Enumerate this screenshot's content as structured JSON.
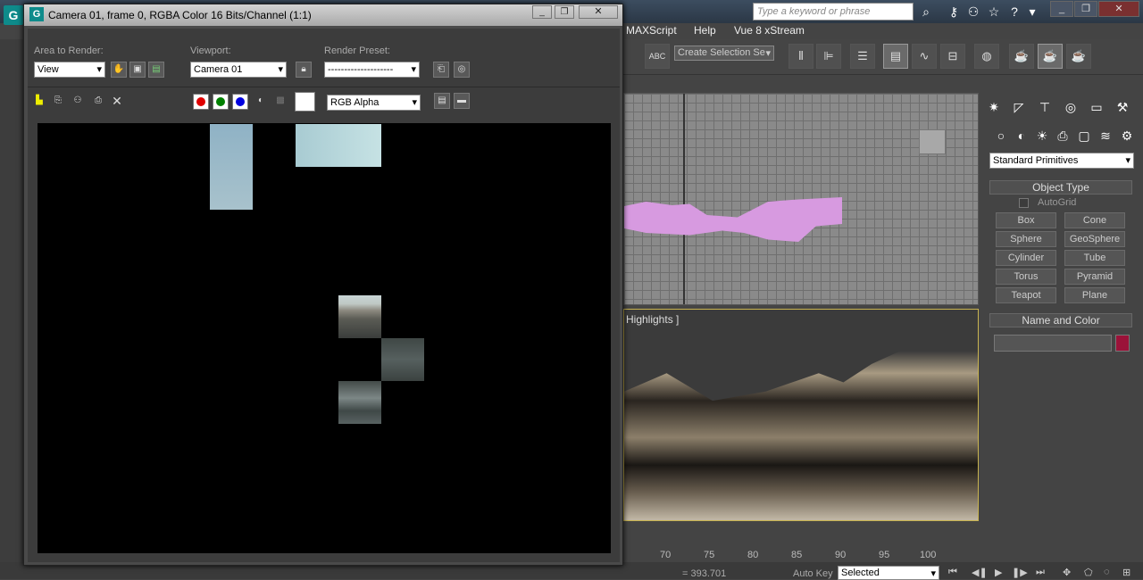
{
  "max": {
    "search_placeholder": "Type a keyword or phrase",
    "menus": [
      "MAXScript",
      "Help",
      "Vue 8 xStream"
    ],
    "selection_set": "Create Selection Se",
    "viewport_label": "Highlights ]",
    "panel": {
      "primitive_type": "Standard Primitives",
      "object_type_header": "Object Type",
      "autogrid": "AutoGrid",
      "buttons": [
        "Box",
        "Cone",
        "Sphere",
        "GeoSphere",
        "Cylinder",
        "Tube",
        "Torus",
        "Pyramid",
        "Teapot",
        "Plane"
      ],
      "name_color_header": "Name and Color",
      "name_value": "",
      "object_color": "#9b1239"
    },
    "ruler_ticks": [
      "70",
      "75",
      "80",
      "85",
      "90",
      "95",
      "100"
    ],
    "status": {
      "coord": "= 393.701",
      "autokey": "Auto Key",
      "key_filter": "Selected"
    }
  },
  "render_window": {
    "title": "Camera 01, frame 0, RGBA Color 16 Bits/Channel (1:1)",
    "area_label": "Area to Render:",
    "area_value": "View",
    "viewport_label": "Viewport:",
    "viewport_value": "Camera 01",
    "preset_label": "Render Preset:",
    "preset_value": "--------------------",
    "channel_display": "RGB Alpha",
    "channel_colors": {
      "red": "#e00000",
      "green": "#008000",
      "blue": "#0000e0"
    }
  }
}
